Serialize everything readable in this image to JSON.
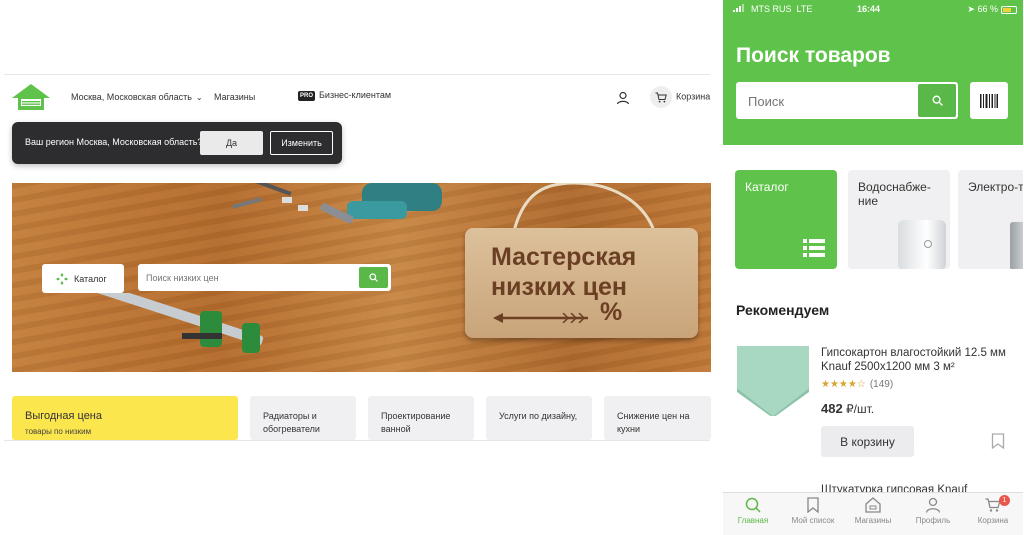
{
  "desktop": {
    "header": {
      "region_label": "Москва, Московская область",
      "stores_label": "Магазины",
      "pro_badge": "PRO",
      "business_label": "Бизнес-клиентам",
      "cart_label": "Корзина"
    },
    "region_popup": {
      "question": "Ваш регион Москва, Московская область?",
      "yes_label": "Да",
      "change_label": "Изменить"
    },
    "banner": {
      "catalog_label": "Каталог",
      "search_placeholder": "Поиск низких цен",
      "sign_line1": "Мастерская",
      "sign_line2": "низких цен",
      "sign_line3": "%"
    },
    "tiles": [
      {
        "title": "Выгодная цена",
        "subtitle": "товары по низким"
      },
      {
        "title": "Радиаторы и обогреватели"
      },
      {
        "title": "Проектирование ванной"
      },
      {
        "title": "Услуги по дизайну,"
      },
      {
        "title": "Снижение цен на кухни"
      }
    ]
  },
  "mobile": {
    "status": {
      "carrier": "MTS RUS",
      "network": "LTE",
      "time": "16:44",
      "battery": "66 %"
    },
    "title": "Поиск товаров",
    "search_placeholder": "Поиск",
    "categories": [
      {
        "label": "Каталог"
      },
      {
        "label": "Водоснабже-ние"
      },
      {
        "label": "Электро-товары"
      }
    ],
    "recommend_title": "Рекомендуем",
    "product": {
      "name": "Гипсокартон влагостойкий 12.5 мм Knauf 2500х1200 мм 3 м²",
      "rating": 4,
      "rating_count": "(149)",
      "price": "482",
      "price_unit": "₽/шт.",
      "cart_button": "В корзину"
    },
    "next_product_name": "Штукатурка гипсовая Knauf",
    "tabs": [
      {
        "label": "Главная",
        "icon": "search-icon"
      },
      {
        "label": "Мой список",
        "icon": "bookmark-icon"
      },
      {
        "label": "Магазины",
        "icon": "store-icon"
      },
      {
        "label": "Профиль",
        "icon": "profile-icon"
      },
      {
        "label": "Корзина",
        "icon": "cart-icon",
        "badge": "1"
      }
    ],
    "colors": {
      "brand_green": "#5fc34b",
      "button_green": "#5ab848",
      "promo_yellow": "#fbe64d",
      "badge_red": "#e8574b"
    }
  }
}
